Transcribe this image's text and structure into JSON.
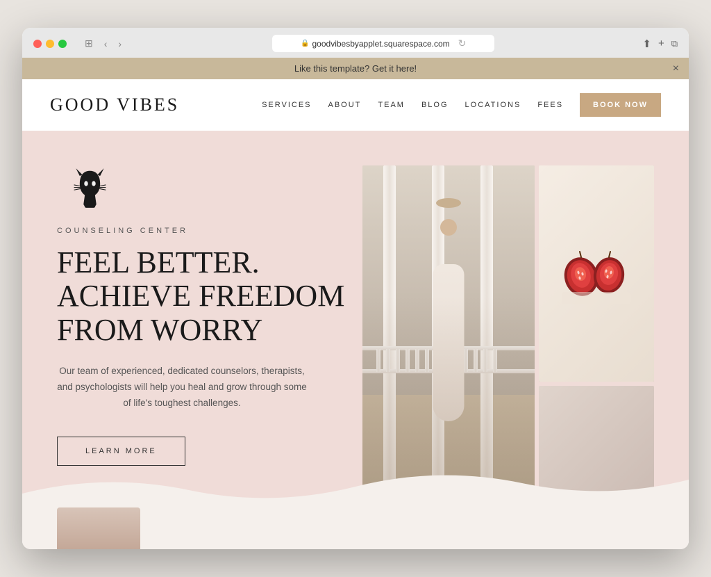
{
  "browser": {
    "url": "goodvibesbyapplet.squarespace.com",
    "window_controls": {
      "close": "close",
      "minimize": "minimize",
      "maximize": "maximize"
    },
    "nav_back": "‹",
    "nav_forward": "›",
    "reload": "↻"
  },
  "announcement": {
    "text": "Like this template? Get it here!",
    "close": "×"
  },
  "site": {
    "logo": "GOOD VIBES",
    "nav_items": [
      "SERVICES",
      "ABOUT",
      "TEAM",
      "BLOG",
      "LOCATIONS",
      "FEES"
    ],
    "book_btn": "BOOK NOW"
  },
  "hero": {
    "label": "COUNSELING CENTER",
    "headline": "FEEL BETTER. ACHIEVE FREEDOM FROM WORRY",
    "body": "Our team of experienced, dedicated counselors, therapists, and psychologists will help you heal and grow through some of life's toughest challenges.",
    "cta": "LEARN MORE"
  },
  "colors": {
    "accent_tan": "#c8a882",
    "hero_bg": "#f0dcd8",
    "banner_bg": "#c8b89a",
    "book_btn_bg": "#c8a882",
    "bottom_wave": "#f5f0ec"
  }
}
